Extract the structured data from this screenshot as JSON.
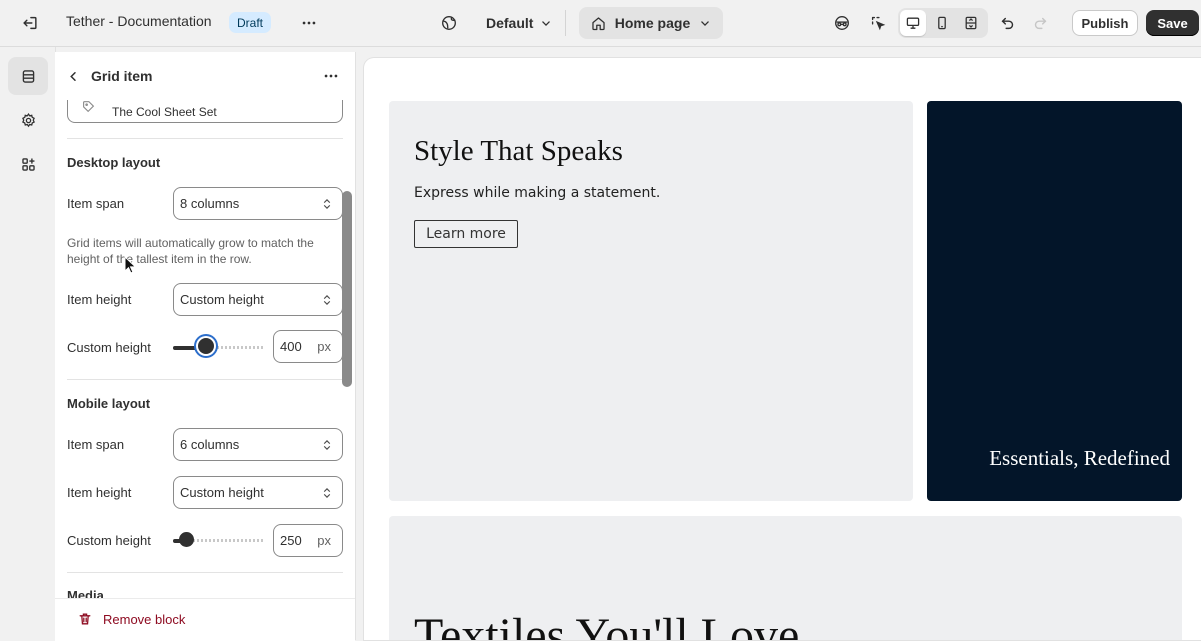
{
  "topbar": {
    "store_title": "Tether - Documentation",
    "status_badge": "Draft",
    "theme_selector": "Default",
    "page_selector": "Home page",
    "publish_label": "Publish",
    "save_label": "Save"
  },
  "rail": {
    "items": [
      "sections-icon",
      "gear-icon",
      "apps-icon"
    ]
  },
  "panel": {
    "title": "Grid item",
    "collection_value": "The Cool Sheet Set",
    "desktop": {
      "section_title": "Desktop layout",
      "item_span_label": "Item span",
      "item_span_value": "8 columns",
      "help_text": "Grid items will automatically grow to match the height of the tallest item in the row.",
      "item_height_label": "Item height",
      "item_height_value": "Custom height",
      "custom_height_label": "Custom height",
      "custom_height_value": "400",
      "unit": "px"
    },
    "mobile": {
      "section_title": "Mobile layout",
      "item_span_label": "Item span",
      "item_span_value": "6 columns",
      "item_height_label": "Item height",
      "item_height_value": "Custom height",
      "custom_height_label": "Custom height",
      "custom_height_value": "250",
      "unit": "px"
    },
    "media_section_title": "Media",
    "remove_label": "Remove block"
  },
  "preview": {
    "hero_heading": "Style That Speaks",
    "hero_subtext": "Express while making a statement.",
    "hero_button": "Learn more",
    "dark_card_text": "Essentials, Redefined",
    "bottom_heading": "Textiles You'll Love"
  },
  "colors": {
    "dark_card": "#031529",
    "light_card": "#eeeff1",
    "draft_badge": "#d5ebff",
    "remove_red": "#8e0b21"
  }
}
